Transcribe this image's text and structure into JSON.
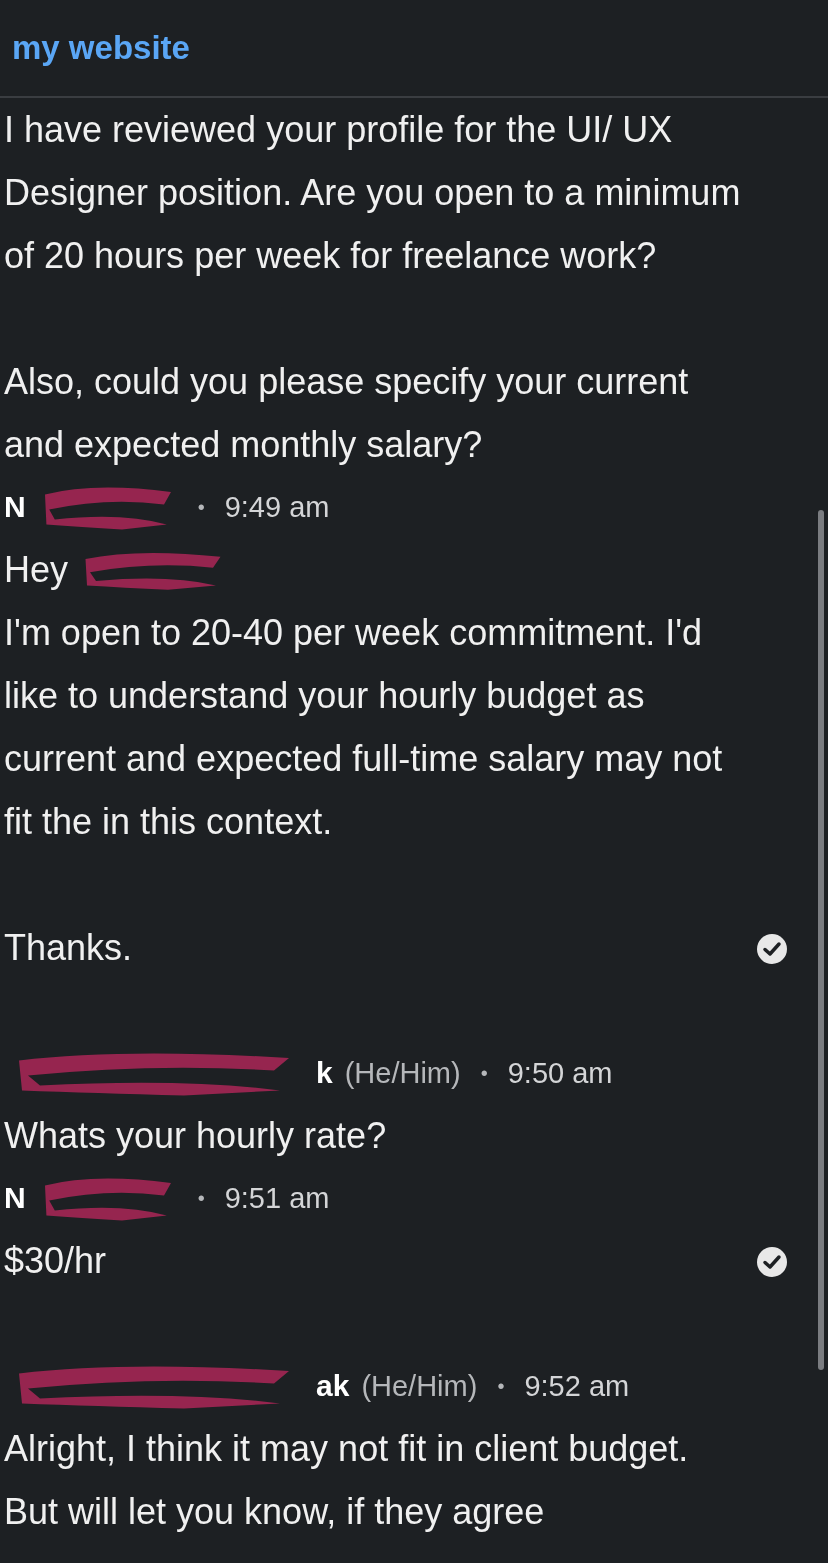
{
  "header": {
    "title": "my website"
  },
  "messages": [
    {
      "kind": "continuation",
      "paragraphs": [
        {
          "parts": [
            "I have reviewed your profile for the UI/ UX Designer position. Are you open to a minimum of 20 hours per week for freelance work?"
          ]
        },
        {
          "parts": [
            "Also, could you please specify your current and expected monthly salary?"
          ]
        }
      ]
    },
    {
      "kind": "message",
      "sender": {
        "name": "N",
        "redacted_after": true,
        "separator": "•",
        "time": "9:49 am"
      },
      "paragraphs": [
        {
          "parts": [
            "Hey",
            "I'm open to 20-40 per week commitment. I'd like to understand your hourly budget as current and expected full-time salary may not fit the in this context."
          ]
        },
        {
          "parts": [
            "Thanks."
          ]
        }
      ],
      "seen": true
    },
    {
      "kind": "message",
      "sender": {
        "name": "k",
        "pronouns": "(He/Him)",
        "redacted_before": true,
        "separator": "•",
        "time": "9:50 am"
      },
      "paragraphs": [
        {
          "parts": [
            "Whats your hourly rate?"
          ]
        }
      ]
    },
    {
      "kind": "message",
      "sender": {
        "name": "N",
        "redacted_after": true,
        "separator": "•",
        "time": "9:51 am"
      },
      "paragraphs": [
        {
          "parts": [
            "$30/hr"
          ]
        }
      ],
      "seen": true
    },
    {
      "kind": "message",
      "sender": {
        "name": "ak",
        "pronouns": "(He/Him)",
        "redacted_before": true,
        "separator": "•",
        "time": "9:52 am"
      },
      "paragraphs": [
        {
          "parts": [
            "Alright, I think it may not fit in client budget. But will let you know, if they agree"
          ]
        }
      ]
    }
  ]
}
